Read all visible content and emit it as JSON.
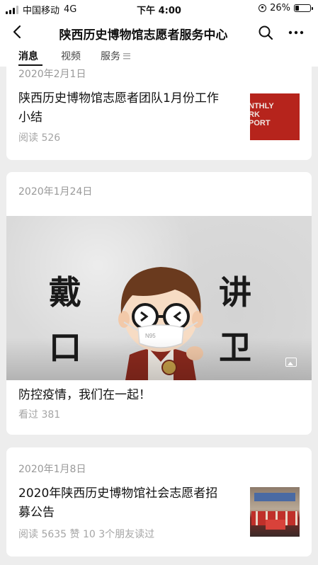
{
  "status_bar": {
    "carrier": "中国移动",
    "network": "4G",
    "time": "下午 4:00",
    "battery": "26%",
    "battery_level": 0.26
  },
  "nav": {
    "title": "陕西历史博物馆志愿者服务中心",
    "back_icon": "back-chevron-icon",
    "search_icon": "search-icon",
    "more_icon": "more-dots-icon"
  },
  "tabs": [
    {
      "label": "消息",
      "active": true
    },
    {
      "label": "视频",
      "active": false
    },
    {
      "label": "服务",
      "active": false
    }
  ],
  "articles": [
    {
      "date": "2020年2月1日",
      "title_lines": [
        "陕西历史博物馆志愿者团队1月份工作",
        "小结"
      ],
      "meta": "阅读 526",
      "thumb_text": [
        "NTHLY",
        "RK",
        "PORT"
      ]
    },
    {
      "date": "2020年1月24日",
      "cover_chars": [
        "戴",
        "口",
        "讲",
        "卫"
      ],
      "mask_text": "N95",
      "title_lines": [
        "防控疫情，我们在一起！"
      ],
      "meta": "看过 381"
    },
    {
      "date": "2020年1月8日",
      "title_lines": [
        "2020年陕西历史博物馆社会志愿者招",
        "募公告"
      ],
      "meta": "阅读 5635   赞 10   3个朋友读过"
    }
  ],
  "colors": {
    "background": "#ededed",
    "card": "#ffffff",
    "muted_text": "#999999",
    "thumb_red": "#b6241c"
  }
}
